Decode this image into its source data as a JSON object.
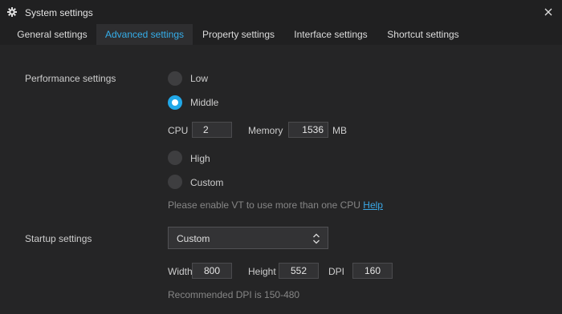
{
  "window": {
    "title": "System settings",
    "icon": "gear-icon",
    "close_icon": "close-icon"
  },
  "tabs": [
    {
      "label": "General settings",
      "active": false
    },
    {
      "label": "Advanced settings",
      "active": true
    },
    {
      "label": "Property settings",
      "active": false
    },
    {
      "label": "Interface settings",
      "active": false
    },
    {
      "label": "Shortcut settings",
      "active": false
    }
  ],
  "performance": {
    "label": "Performance settings",
    "options": [
      {
        "label": "Low",
        "checked": false
      },
      {
        "label": "Middle",
        "checked": true
      },
      {
        "label": "High",
        "checked": false
      },
      {
        "label": "Custom",
        "checked": false
      }
    ],
    "cpu_label": "CPU",
    "cpu_value": "2",
    "memory_label": "Memory",
    "memory_value": "1536",
    "memory_unit": "MB",
    "vt_hint": "Please enable VT to use more than one CPU",
    "help_link": "Help"
  },
  "startup": {
    "label": "Startup settings",
    "selected": "Custom",
    "width_label": "Width",
    "width_value": "800",
    "height_label": "Height",
    "height_value": "552",
    "dpi_label": "DPI",
    "dpi_value": "160",
    "dpi_hint": "Recommended DPI is 150-480"
  },
  "colors": {
    "accent": "#21a8e8",
    "tab_active_text": "#35aeea",
    "background": "#252526",
    "titlebar": "#202021"
  }
}
